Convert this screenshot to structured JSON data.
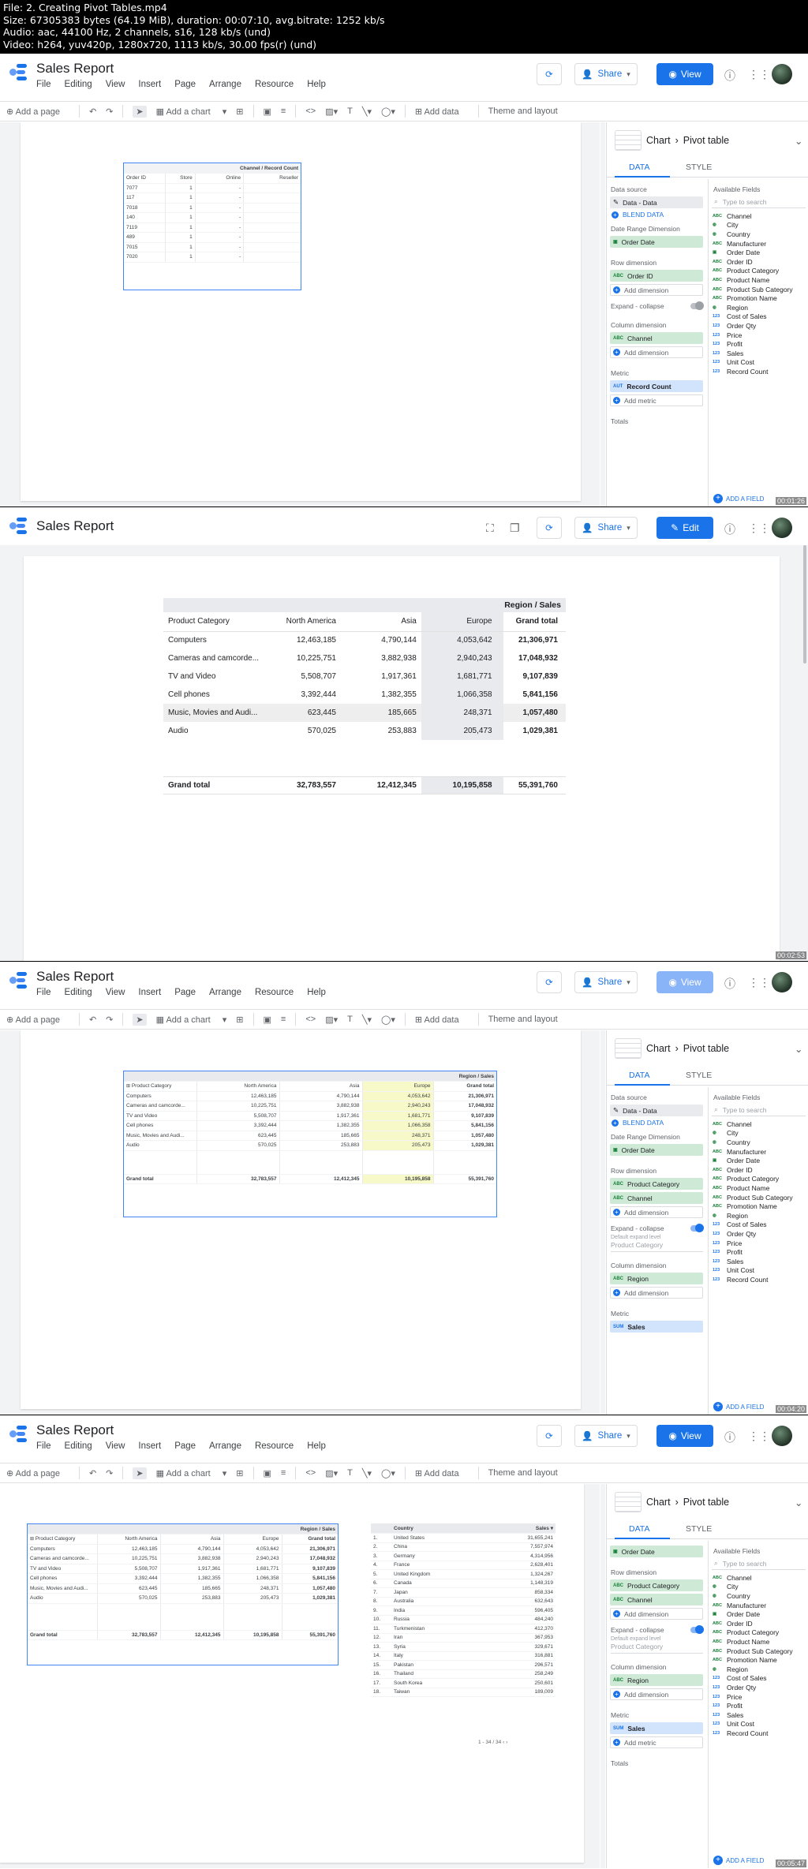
{
  "meta": {
    "lines": [
      "File: 2. Creating Pivot Tables.mp4",
      "Size: 67305383 bytes (64.19 MiB), duration: 00:07:10, avg.bitrate: 1252 kb/s",
      "Audio: aac, 44100 Hz, 2 channels, s16, 128 kb/s (und)",
      "Video: h264, yuv420p, 1280x720, 1113 kb/s, 30.00 fps(r) (und)"
    ]
  },
  "app": {
    "title": "Sales Report",
    "menus": [
      "File",
      "Editing",
      "View",
      "Insert",
      "Page",
      "Arrange",
      "Resource",
      "Help"
    ],
    "share_label": "Share",
    "view_label": "View",
    "edit_label": "Edit"
  },
  "toolbar": {
    "add_page": "Add a page",
    "add_chart": "Add a chart",
    "add_data": "Add data",
    "theme": "Theme and layout"
  },
  "panel": {
    "breadcrumb_chart": "Chart",
    "breadcrumb_type": "Pivot table",
    "tab_data": "DATA",
    "tab_style": "STYLE",
    "data_source_label": "Data source",
    "data_source": "Data - Data",
    "blend": "BLEND DATA",
    "date_range_label": "Date Range Dimension",
    "date_range": "Order Date",
    "row_dim_label": "Row dimension",
    "col_dim_label": "Column dimension",
    "metric_label": "Metric",
    "expand_label": "Expand - collapse",
    "default_expand": "Default expand level",
    "totals_label": "Totals",
    "add_dimension": "Add dimension",
    "add_metric": "Add metric",
    "available_fields": "Available Fields",
    "search_placeholder": "Type to search",
    "add_field": "ADD A FIELD",
    "fields": [
      "Channel",
      "City",
      "Country",
      "Manufacturer",
      "Order Date",
      "Order ID",
      "Product Category",
      "Product Name",
      "Product Sub Category",
      "Promotion Name",
      "Region",
      "Cost of Sales",
      "Order Qty",
      "Price",
      "Profit",
      "Sales",
      "Unit Cost",
      "Record Count"
    ],
    "field_types": [
      "ABC",
      "geo",
      "geo",
      "ABC",
      "date",
      "ABC",
      "ABC",
      "ABC",
      "ABC",
      "ABC",
      "geo",
      "123",
      "123",
      "123",
      "123",
      "123",
      "123",
      "123"
    ]
  },
  "frame1": {
    "row_dim": "Order ID",
    "col_dim": "Channel",
    "metric": "Record Count",
    "metric_type": "AUT",
    "table_header": "Channel / Record Count",
    "columns": [
      "Order ID",
      "Store",
      "Online",
      "Reseller"
    ],
    "rows": [
      [
        "7077",
        "1",
        "-"
      ],
      [
        "117",
        "1",
        "-"
      ],
      [
        "7018",
        "1",
        "-"
      ],
      [
        "140",
        "1",
        "-"
      ],
      [
        "7119",
        "1",
        "-"
      ],
      [
        "489",
        "1",
        "-"
      ],
      [
        "7015",
        "1",
        "-"
      ],
      [
        "7020",
        "1",
        "-"
      ]
    ],
    "timestamp": "00:01:26"
  },
  "pivot": {
    "header": "Region / Sales",
    "row_header": "Product Category",
    "columns": [
      "North America",
      "Asia",
      "Europe",
      "Grand total"
    ],
    "rows": [
      {
        "cat": "Computers",
        "v": [
          "12,463,185",
          "4,790,144",
          "4,053,642",
          "21,306,971"
        ]
      },
      {
        "cat": "Cameras and camcorde...",
        "v": [
          "10,225,751",
          "3,882,938",
          "2,940,243",
          "17,048,932"
        ]
      },
      {
        "cat": "TV and Video",
        "v": [
          "5,508,707",
          "1,917,361",
          "1,681,771",
          "9,107,839"
        ]
      },
      {
        "cat": "Cell phones",
        "v": [
          "3,392,444",
          "1,382,355",
          "1,066,358",
          "5,841,156"
        ]
      },
      {
        "cat": "Music, Movies and Audi...",
        "v": [
          "623,445",
          "185,665",
          "248,371",
          "1,057,480"
        ]
      },
      {
        "cat": "Audio",
        "v": [
          "570,025",
          "253,883",
          "205,473",
          "1,029,381"
        ]
      }
    ],
    "total_label": "Grand total",
    "totals": [
      "32,783,557",
      "12,412,345",
      "10,195,858",
      "55,391,760"
    ],
    "timestamp2": "00:02:53",
    "timestamp3": "00:04:20"
  },
  "frame3": {
    "row_dims": [
      "Product Category",
      "Channel"
    ],
    "col_dim": "Region",
    "metric": "Sales",
    "metric_type": "SUM",
    "default_expand_value": "Product Category"
  },
  "country_table": {
    "col_country": "Country",
    "col_sales": "Sales",
    "rows": [
      [
        "1.",
        "United States",
        "31,655,241"
      ],
      [
        "2.",
        "China",
        "7,557,974"
      ],
      [
        "3.",
        "Germany",
        "4,314,956"
      ],
      [
        "4.",
        "France",
        "2,628,401"
      ],
      [
        "5.",
        "United Kingdom",
        "1,324,267"
      ],
      [
        "6.",
        "Canada",
        "1,148,319"
      ],
      [
        "7.",
        "Japan",
        "858,334"
      ],
      [
        "8.",
        "Australia",
        "632,643"
      ],
      [
        "9.",
        "India",
        "596,405"
      ],
      [
        "10.",
        "Russia",
        "484,240"
      ],
      [
        "11.",
        "Turkmenistan",
        "412,370"
      ],
      [
        "12.",
        "Iran",
        "367,953"
      ],
      [
        "13.",
        "Syria",
        "329,671"
      ],
      [
        "14.",
        "Italy",
        "316,881"
      ],
      [
        "15.",
        "Pakistan",
        "296,571"
      ],
      [
        "16.",
        "Thailand",
        "258,249"
      ],
      [
        "17.",
        "South Korea",
        "250,601"
      ],
      [
        "18.",
        "Taiwan",
        "189,009"
      ]
    ],
    "pagination": "1 - 34 / 34",
    "timestamp": "00:05:47"
  }
}
